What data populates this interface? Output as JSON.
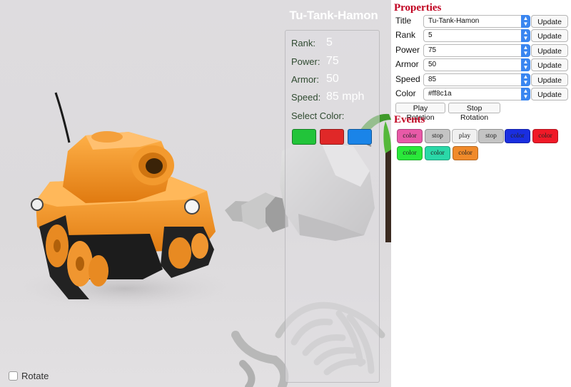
{
  "scene": {
    "tank_title": "Tu-Tank-Hamon",
    "stats": [
      {
        "label": "Rank:",
        "value": "5"
      },
      {
        "label": "Power:",
        "value": "75"
      },
      {
        "label": "Armor:",
        "value": "50"
      },
      {
        "label": "Speed:",
        "value": "85 mph"
      }
    ],
    "select_color_label": "Select Color:",
    "swatches": [
      {
        "name": "green",
        "color": "#22c43a"
      },
      {
        "name": "red",
        "color": "#e02828"
      },
      {
        "name": "blue",
        "color": "#1a84e8"
      }
    ],
    "rotate_label": "Rotate",
    "rotate_checked": false,
    "tank_color": "#ff8c1a"
  },
  "properties": {
    "heading": "Properties",
    "rows": [
      {
        "label": "Title",
        "value": "Tu-Tank-Hamon",
        "button": "Update"
      },
      {
        "label": "Rank",
        "value": "5",
        "button": "Update"
      },
      {
        "label": "Power",
        "value": "75",
        "button": "Update"
      },
      {
        "label": "Armor",
        "value": "50",
        "button": "Update"
      },
      {
        "label": "Speed",
        "value": "85",
        "button": "Update"
      },
      {
        "label": "Color",
        "value": "#ff8c1a",
        "button": "Update"
      }
    ],
    "play_rotation": "Play Rotation",
    "stop_rotation": "Stop Rotation"
  },
  "events": {
    "heading": "Events",
    "items": [
      {
        "label": "color",
        "bg": "#e85aa8"
      },
      {
        "label": "stop",
        "bg": "#c4c4c4"
      },
      {
        "label": "play",
        "bg": "#f0f0f0"
      },
      {
        "label": "stop",
        "bg": "#c4c4c4"
      },
      {
        "label": "color",
        "bg": "#1a2ee0"
      },
      {
        "label": "color",
        "bg": "#f01a28"
      },
      {
        "label": "color",
        "bg": "#2ae83a"
      },
      {
        "label": "color",
        "bg": "#2ad8a8"
      },
      {
        "label": "color",
        "bg": "#f08a2a"
      }
    ]
  }
}
